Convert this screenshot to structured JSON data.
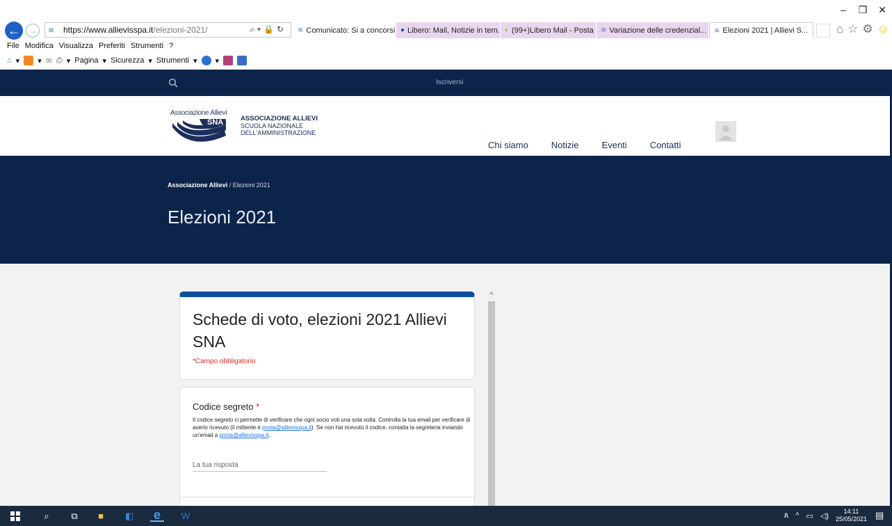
{
  "browser": {
    "url_host": "https://www.allievisspa.it",
    "url_path": "/elezioni-2021/",
    "tabs": [
      {
        "label": "Comunicato: Si a concorsi, ...",
        "active": false
      },
      {
        "label": "Libero: Mail, Notizie in tem...",
        "active": false
      },
      {
        "label": "(99+)Libero Mail - Posta",
        "active": false
      },
      {
        "label": "Variazione delle credenzial...",
        "active": false
      },
      {
        "label": "Elezioni 2021 | Allievi S...",
        "active": true
      }
    ],
    "menu": [
      "File",
      "Modifica",
      "Visualizza",
      "Preferiti",
      "Strumenti",
      "?"
    ],
    "cmd": {
      "page": "Pagina",
      "safety": "Sicurezza",
      "tools": "Strumenti"
    }
  },
  "site": {
    "topbar_signup": "Iscriversi",
    "logo_text": "Associazione Allievi",
    "logo_mark": "SNA",
    "brand": {
      "line1": "ASSOCIAZIONE ALLIEVI",
      "line2": "SCUOLA NAZIONALE",
      "line3": "DELL'AMMINISTRAZIONE"
    },
    "nav": [
      "Chi siamo",
      "Notizie",
      "Eventi",
      "Contatti"
    ],
    "breadcrumb": {
      "home": "Associazione Allievi",
      "sep": "/",
      "current": "Elezioni 2021"
    },
    "page_title": "Elezioni 2021"
  },
  "form": {
    "title": "Schede di voto, elezioni 2021 Allievi SNA",
    "required_note": "*Campo obbligatorio",
    "q1": {
      "title": "Codice segreto",
      "star": "*",
      "desc_part1": "Il codice segreto ci permette di verificare che ogni socio voti una sola volta. Controlla la tua email per verificare di averlo ricevuto (il mittente è ",
      "email": "posta@allievisspa.it",
      "desc_part2": "). Se non hai ricevuto il codice, contatta la segreteria inviando un'email a ",
      "desc_part3": ".",
      "placeholder": "La tua risposta"
    }
  },
  "taskbar": {
    "time": "14:11",
    "date": "25/05/2021"
  }
}
